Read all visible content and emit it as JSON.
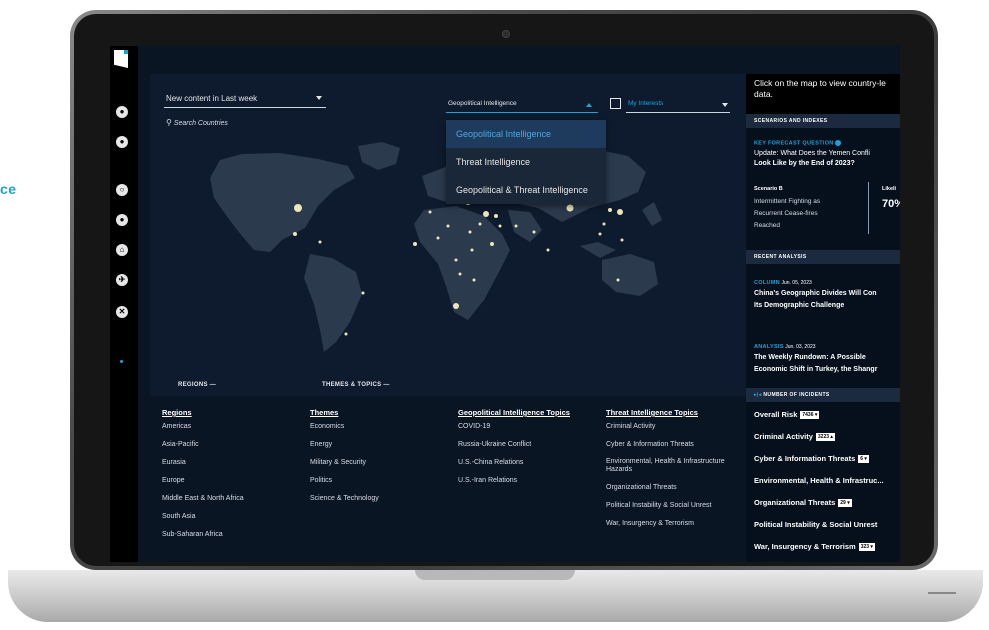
{
  "page_fragment": "ce",
  "map": {
    "content_filter": "New content in Last week",
    "search_placeholder": "Search Countries",
    "product_filter": "Geopolitical Intelligence",
    "interests_label": "My Interests",
    "dropdown_options": [
      "Geopolitical Intelligence",
      "Threat Intelligence",
      "Geopolitical & Threat Intelligence"
    ],
    "regions_collapse": "REGIONS —",
    "themes_collapse": "THEMES & TOPICS —"
  },
  "topics": {
    "regions": {
      "title": "Regions",
      "items": [
        "Americas",
        "Asia-Pacific",
        "Eurasia",
        "Europe",
        "Middle East & North Africa",
        "South Asia",
        "Sub-Saharan Africa"
      ]
    },
    "themes": {
      "title": "Themes",
      "items": [
        "Economics",
        "Energy",
        "Military & Security",
        "Politics",
        "Science & Technology"
      ]
    },
    "geo_topics": {
      "title": "Geopolitical Intelligence Topics",
      "items": [
        "COVID-19",
        "Russia-Ukraine Conflict",
        "U.S.-China Relations",
        "U.S.-Iran Relations"
      ]
    },
    "threat_topics": {
      "title": "Threat Intelligence Topics",
      "items": [
        "Criminal Activity",
        "Cyber & Information Threats",
        "Environmental, Health & Infrastructure Hazards",
        "Organizational Threats",
        "Political Instability & Social Unrest",
        "War, Insurgency & Terrorism"
      ]
    }
  },
  "right_panel": {
    "intro_line1": "Click on the map to view country-le",
    "intro_line2": "data.",
    "scenarios_header": "SCENARIOS AND INDEXES",
    "key_forecast_label": "KEY FORECAST QUESTION",
    "forecast_q1": "Update: What Does the Yemen Confli",
    "forecast_q2": "Look Like by the End of 2023?",
    "scenario_label": "Scenario B",
    "scenario_l1": "Intermittent Fighting as",
    "scenario_l2": "Recurrent Cease-fires",
    "scenario_l3": "Reached",
    "likelihood_label": "Likeli",
    "likelihood_value": "70%",
    "recent_header": "RECENT ANALYSIS",
    "a1_type": "COLUMN",
    "a1_date": "Jun. 05, 2023",
    "a1_title1": "China's Geographic Divides Will Con",
    "a1_title2": "Its Demographic Challenge",
    "a2_type": "ANALYSIS",
    "a2_date": "Jun. 03, 2023",
    "a2_title1": "The Weekly Rundown: A Possible",
    "a2_title2": "Economic Shift in Turkey, the Shangr",
    "incidents_header": "NUMBER OF INCIDENTS",
    "incidents": [
      {
        "label": "Overall Risk",
        "count": "7436"
      },
      {
        "label": "Criminal Activity",
        "count": "3223"
      },
      {
        "label": "Cyber & Information Threats",
        "count": "6"
      },
      {
        "label": "Environmental, Health & Infrastruc...",
        "count": ""
      },
      {
        "label": "Organizational Threats",
        "count": "29"
      },
      {
        "label": "Political Instability & Social Unrest",
        "count": ""
      },
      {
        "label": "War, Insurgency & Terrorism",
        "count": "323"
      }
    ]
  }
}
